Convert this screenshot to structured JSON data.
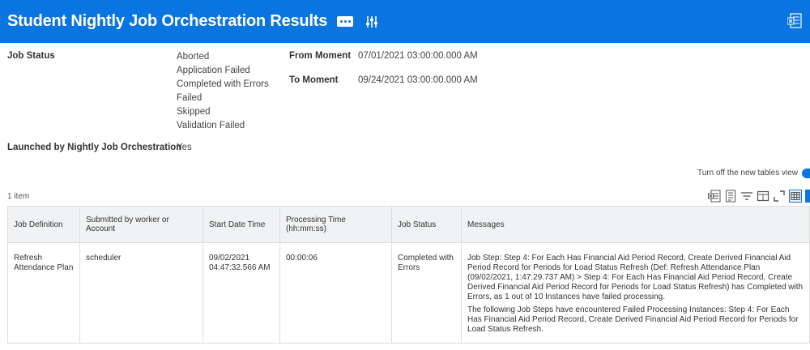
{
  "header": {
    "title": "Student Nightly Job Orchestration Results",
    "icons": [
      "more-icon",
      "tune-icon",
      "export-to-excel-icon"
    ]
  },
  "filters": {
    "job_status_label": "Job Status",
    "job_status_values": [
      "Aborted",
      "Application Failed",
      "Completed with Errors",
      "Failed",
      "Skipped",
      "Validation Failed"
    ],
    "from_moment_label": "From Moment",
    "from_moment_value": "07/01/2021 03:00:00.000 AM",
    "to_moment_label": "To Moment",
    "to_moment_value": "09/24/2021 03:00:00.000 AM",
    "launched_label": "Launched by Nightly Job Orchestration",
    "launched_value": "Yes"
  },
  "view_toggle": {
    "label": "Turn off the new tables view",
    "on": true
  },
  "grid": {
    "item_count": "1 item",
    "columns": [
      "Job Definition",
      "Submitted by worker or Account",
      "Start Date Time",
      "Processing Time (hh:mm:ss)",
      "Job Status",
      "Messages"
    ],
    "rows": [
      {
        "job_definition": "Refresh Attendance Plan",
        "submitted_by": "scheduler",
        "start_date_time": "09/02/2021 04:47:32.566 AM",
        "processing_time": "00:00:06",
        "job_status": "Completed with Errors",
        "message_1": "Job Step: Step 4: For Each Has Financial Aid Period Record, Create Derived Financial Aid Period Record for Periods for Load Status Refresh (Def: Refresh Attendance Plan (09/02/2021, 1:47:29.737 AM) > Step 4: For Each Has Financial Aid Period Record, Create Derived Financial Aid Period Record for Periods for Load Status Refresh) has Completed with Errors, as 1 out of 10 Instances have failed processing.",
        "message_2": "The following Job Steps have encountered Failed Processing Instances: Step 4: For Each Has Financial Aid Period Record, Create Derived Financial Aid Period Record for Periods for Load Status Refresh."
      }
    ]
  },
  "colors": {
    "header_bg": "#0875e1",
    "table_header_bg": "#f1f2f3"
  }
}
